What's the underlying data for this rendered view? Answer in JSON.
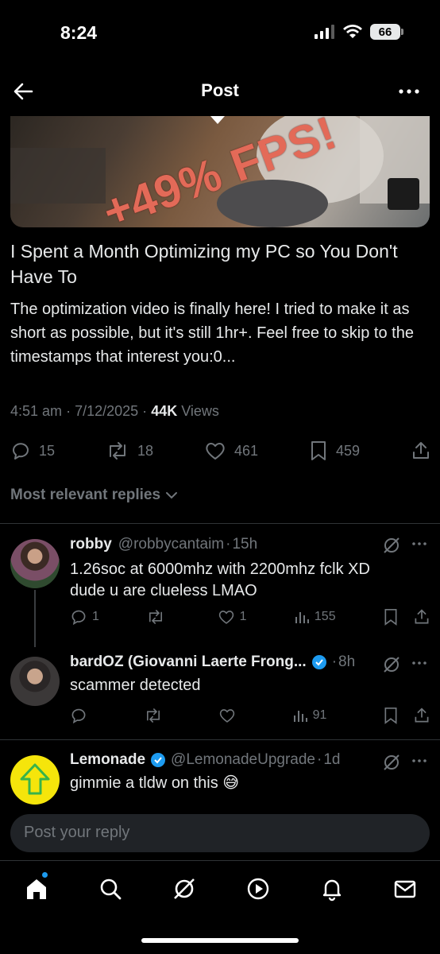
{
  "status_bar": {
    "time": "8:24",
    "battery": "66"
  },
  "header": {
    "title": "Post"
  },
  "thumbnail": {
    "overlay_text": "+49% FPS!"
  },
  "post": {
    "title": "I Spent a Month Optimizing my PC so You Don't Have To",
    "body": "The optimization video is finally here! I tried to make it as short as possible, but it's still 1hr+. Feel free to skip to the timestamps that interest you:0...",
    "time": "4:51 am",
    "date": "7/12/2025",
    "dot": "·",
    "views_count": "44K",
    "views_label": "Views",
    "replies": "15",
    "reposts": "18",
    "likes": "461",
    "bookmarks": "459"
  },
  "replies_header": "Most relevant replies",
  "replies": [
    {
      "name": "robby",
      "handle": "@robbycantaim",
      "time": "15h",
      "text_line1": "1.26soc at 6000mhz with 2200mhz fclk XD",
      "text_line2": "dude u are clueless LMAO",
      "replies": "1",
      "reposts": "",
      "likes": "1",
      "views": "155"
    },
    {
      "name": "bardOZ (Giovanni Laerte Frong...",
      "handle": "",
      "time": "8h",
      "text_line1": "scammer detected",
      "replies": "",
      "reposts": "",
      "likes": "",
      "views": "91"
    },
    {
      "name": "Lemonade",
      "handle": "@LemonadeUpgrade",
      "time": "1d",
      "text_line1": "gimmie a tldw on this 😅"
    }
  ],
  "reply_box": {
    "placeholder": "Post your reply"
  },
  "colors": {
    "accent": "#1d9bf0",
    "muted": "#71767b",
    "background": "#000000",
    "lemonade_bg": "#f5e50b",
    "lemonade_arrow": "#37b34a"
  },
  "icons": [
    "back-arrow-icon",
    "more-icon",
    "reply-icon",
    "repost-icon",
    "like-icon",
    "bookmark-icon",
    "share-icon",
    "grok-icon",
    "views-icon",
    "verified-icon",
    "home-icon",
    "search-icon",
    "video-icon",
    "bell-icon",
    "mail-icon"
  ]
}
